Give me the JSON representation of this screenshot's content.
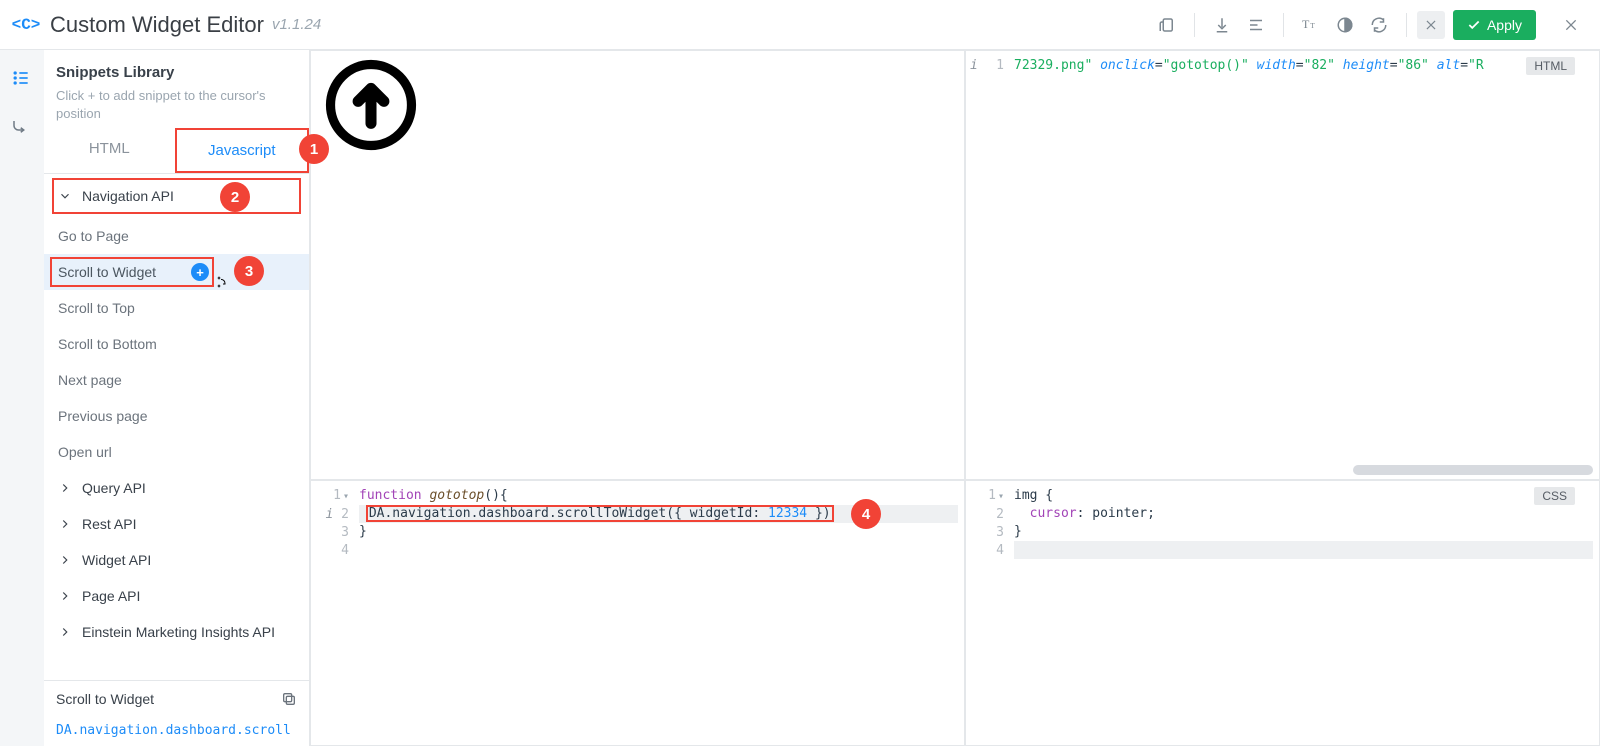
{
  "header": {
    "logo_text": "<C>",
    "title": "Custom Widget Editor",
    "version": "v1.1.24",
    "apply_label": "Apply"
  },
  "sidebar": {
    "title": "Snippets Library",
    "description": "Click + to add snippet to the cursor's position",
    "tabs": {
      "html": "HTML",
      "js": "Javascript"
    },
    "active_tab": "Javascript",
    "groups": {
      "expanded_label": "Navigation API",
      "items": [
        "Go to Page",
        "Scroll to Widget",
        "Scroll to Top",
        "Scroll to Bottom",
        "Next page",
        "Previous page",
        "Open url"
      ],
      "collapsed": [
        "Query API",
        "Rest API",
        "Widget API",
        "Page API",
        "Einstein Marketing Insights API"
      ]
    },
    "detail": {
      "title": "Scroll to Widget",
      "code": "DA.navigation.dashboard.scroll"
    }
  },
  "markers": {
    "m1": "1",
    "m2": "2",
    "m3": "3",
    "m4": "4"
  },
  "editors": {
    "html": {
      "badge": "HTML",
      "gutter_info": "i",
      "line_no": "1",
      "frag_str1": "72329.png\"",
      "frag_attr_onclick": "onclick",
      "frag_eq1": "=",
      "frag_val_onclick": "\"gototop()\"",
      "frag_attr_width": "width",
      "frag_val_width": "\"82\"",
      "frag_attr_height": "height",
      "frag_val_height": "\"86\"",
      "frag_attr_alt": "alt",
      "frag_val_alt_partial": "\"R",
      "frag_tail": ">"
    },
    "js": {
      "lines": {
        "l1_no": "1",
        "l2_no": "2",
        "l3_no": "3",
        "l4_no": "4",
        "kw_function": "function",
        "fn_name": "gototop",
        "paren_open": "(){",
        "call_pre": "DA.navigation.dashboard.scrollToWidget({ widgetId: ",
        "call_num": "12334",
        "call_post": " })",
        "close": "}",
        "info": "i"
      }
    },
    "css": {
      "badge": "CSS",
      "l1_no": "1",
      "l2_no": "2",
      "l3_no": "3",
      "l4_no": "4",
      "sel": "img {",
      "prop": "cursor",
      "colon": ": ",
      "val": "pointer;",
      "close": "}"
    }
  }
}
